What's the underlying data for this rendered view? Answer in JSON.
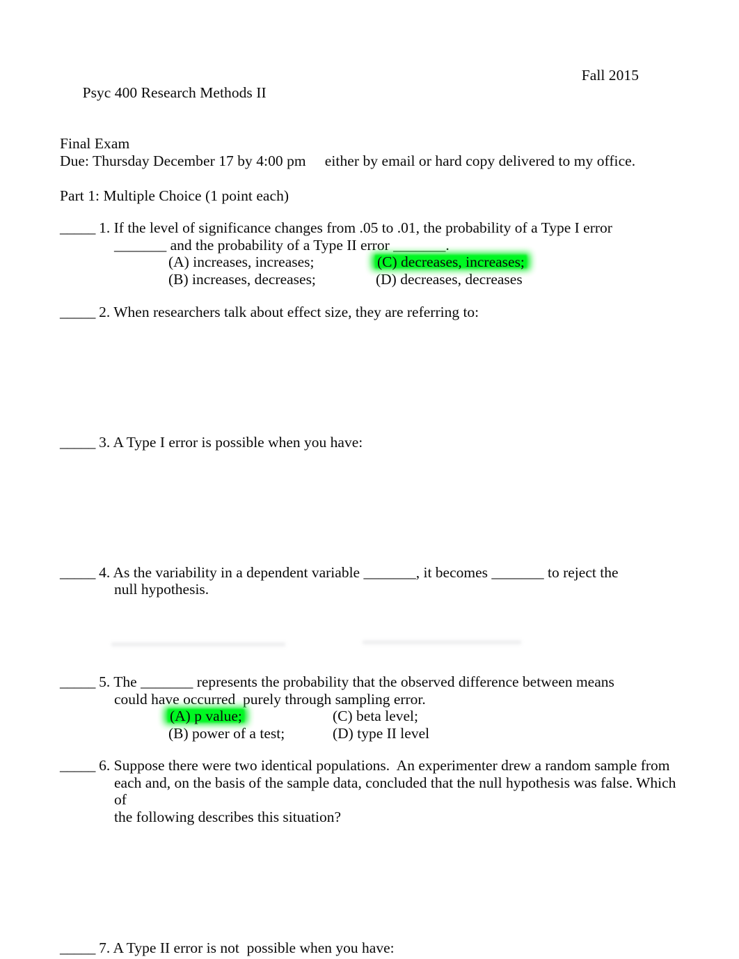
{
  "document": {
    "header": {
      "course": "Psyc 400 Research Methods II",
      "term": "Fall 2015",
      "exam_title": "Final Exam",
      "due_line": "Due: Thursday December 17 by 4:00 pm     either by email or hard copy delivered to my office."
    },
    "part_heading": "Part 1: Multiple Choice (1 point each)",
    "answer_blank": "_____",
    "inline_blank": "_______",
    "questions": [
      {
        "number": "1.",
        "lines": [
          "If the level of significance changes from .05 to .01, the probability of a Type I error",
          "_______ and the probability of a Type II error _______."
        ],
        "options": [
          {
            "label": "(A) increases, increases;",
            "highlighted": false
          },
          {
            "label": "(B) increases, decreases;",
            "highlighted": false
          },
          {
            "label": "(C) decreases, increases;",
            "highlighted": true
          },
          {
            "label": "(D) decreases, decreases",
            "highlighted": false
          }
        ]
      },
      {
        "number": "2.",
        "lines": [
          "When researchers talk about effect size, they are referring to:"
        ],
        "options": []
      },
      {
        "number": "3.",
        "lines": [
          "A Type I error is possible when you have:"
        ],
        "options": []
      },
      {
        "number": "4.",
        "lines": [
          "As the variability in a dependent variable _______, it becomes _______ to reject the",
          "null hypothesis."
        ],
        "options": []
      },
      {
        "number": "5.",
        "lines": [
          "The _______ represents the probability that the observed difference between means",
          "could have occurred  purely through sampling error."
        ],
        "options": [
          {
            "label": "(A) p value;",
            "highlighted": true
          },
          {
            "label": "(B) power of a test;",
            "highlighted": false
          },
          {
            "label": "(C) beta level;",
            "highlighted": false
          },
          {
            "label": "(D) type II level",
            "highlighted": false
          }
        ]
      },
      {
        "number": "6.",
        "lines": [
          "Suppose there were two identical populations.  An experimenter drew a random sample from",
          "each and, on the basis of the sample data, concluded that the null hypothesis was false. Which of",
          "the following describes this situation?"
        ],
        "options": []
      },
      {
        "number": "7.",
        "lines": [
          "A Type II error is not  possible when you have:"
        ],
        "options": []
      }
    ],
    "colors": {
      "highlight_green": "#00ee1e",
      "text": "#0a0a0a",
      "page_background": "#ffffff"
    }
  }
}
